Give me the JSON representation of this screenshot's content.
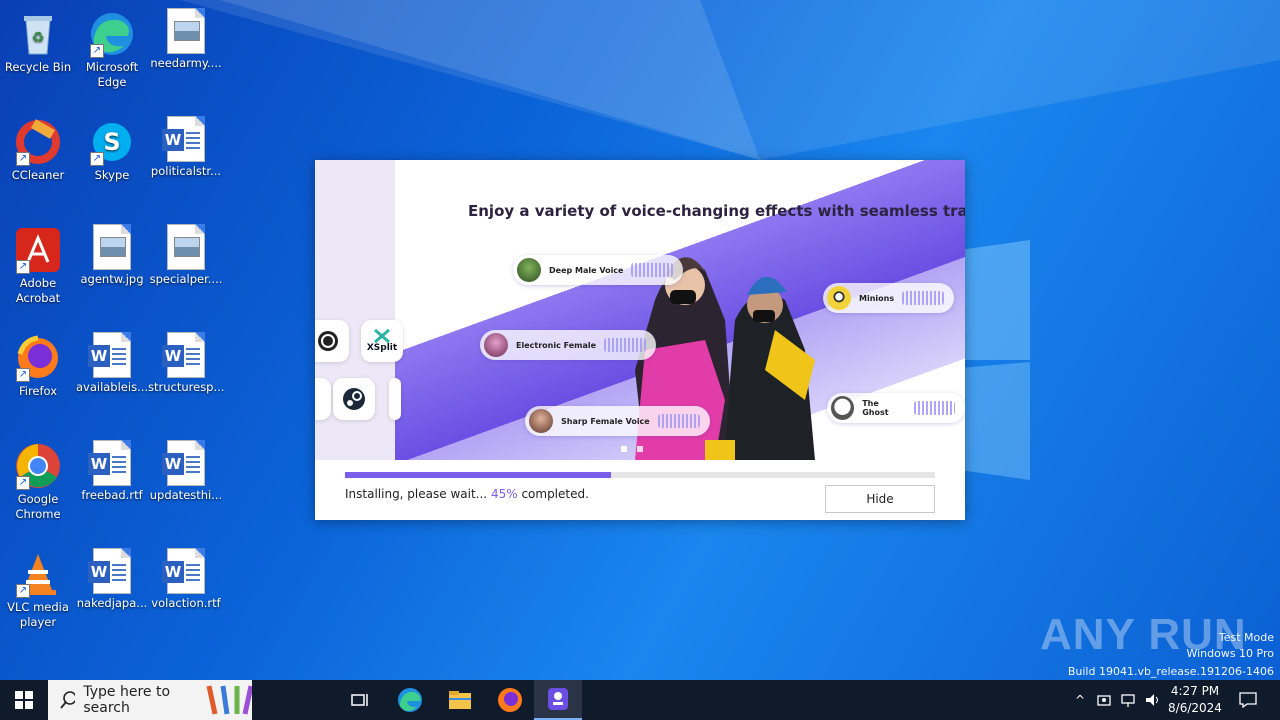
{
  "desktop": {
    "icons": [
      {
        "label": "Recycle Bin"
      },
      {
        "label": "Microsoft Edge"
      },
      {
        "label": "needarmy...."
      },
      {
        "label": "CCleaner"
      },
      {
        "label": "Skype"
      },
      {
        "label": "politicalstr..."
      },
      {
        "label": "Adobe Acrobat"
      },
      {
        "label": "agentw.jpg"
      },
      {
        "label": "specialper...."
      },
      {
        "label": "Firefox"
      },
      {
        "label": "availableis..."
      },
      {
        "label": "structuresp..."
      },
      {
        "label": "Google Chrome"
      },
      {
        "label": "freebad.rtf"
      },
      {
        "label": "updatesthi..."
      },
      {
        "label": "VLC media player"
      },
      {
        "label": "nakedjapa..."
      },
      {
        "label": "volaction.rtf"
      }
    ]
  },
  "installer": {
    "headline": "Enjoy a variety of voice-changing effects with seamless transitions",
    "voices": [
      {
        "label": "Deep Male Voice"
      },
      {
        "label": "Minions"
      },
      {
        "label": "Electronic Female"
      },
      {
        "label": "The Ghost"
      },
      {
        "label": "Sharp Female Voice"
      }
    ],
    "apps": [
      {
        "label": "XSplit"
      }
    ],
    "progress_percent": 45,
    "status_prefix": "Installing, please wait...",
    "status_pct": "45%",
    "status_suffix": "completed.",
    "hide_label": "Hide"
  },
  "watermark": {
    "brand": "ANY RUN",
    "mode": "Test Mode",
    "edition": "Windows 10 Pro",
    "build": "Build 19041.vb_release.191206-1406"
  },
  "taskbar": {
    "search_placeholder": "Type here to search",
    "time": "4:27 PM",
    "date": "8/6/2024"
  },
  "colors": {
    "accent": "#7b5fe8",
    "taskbar": "#0f1a2b"
  }
}
